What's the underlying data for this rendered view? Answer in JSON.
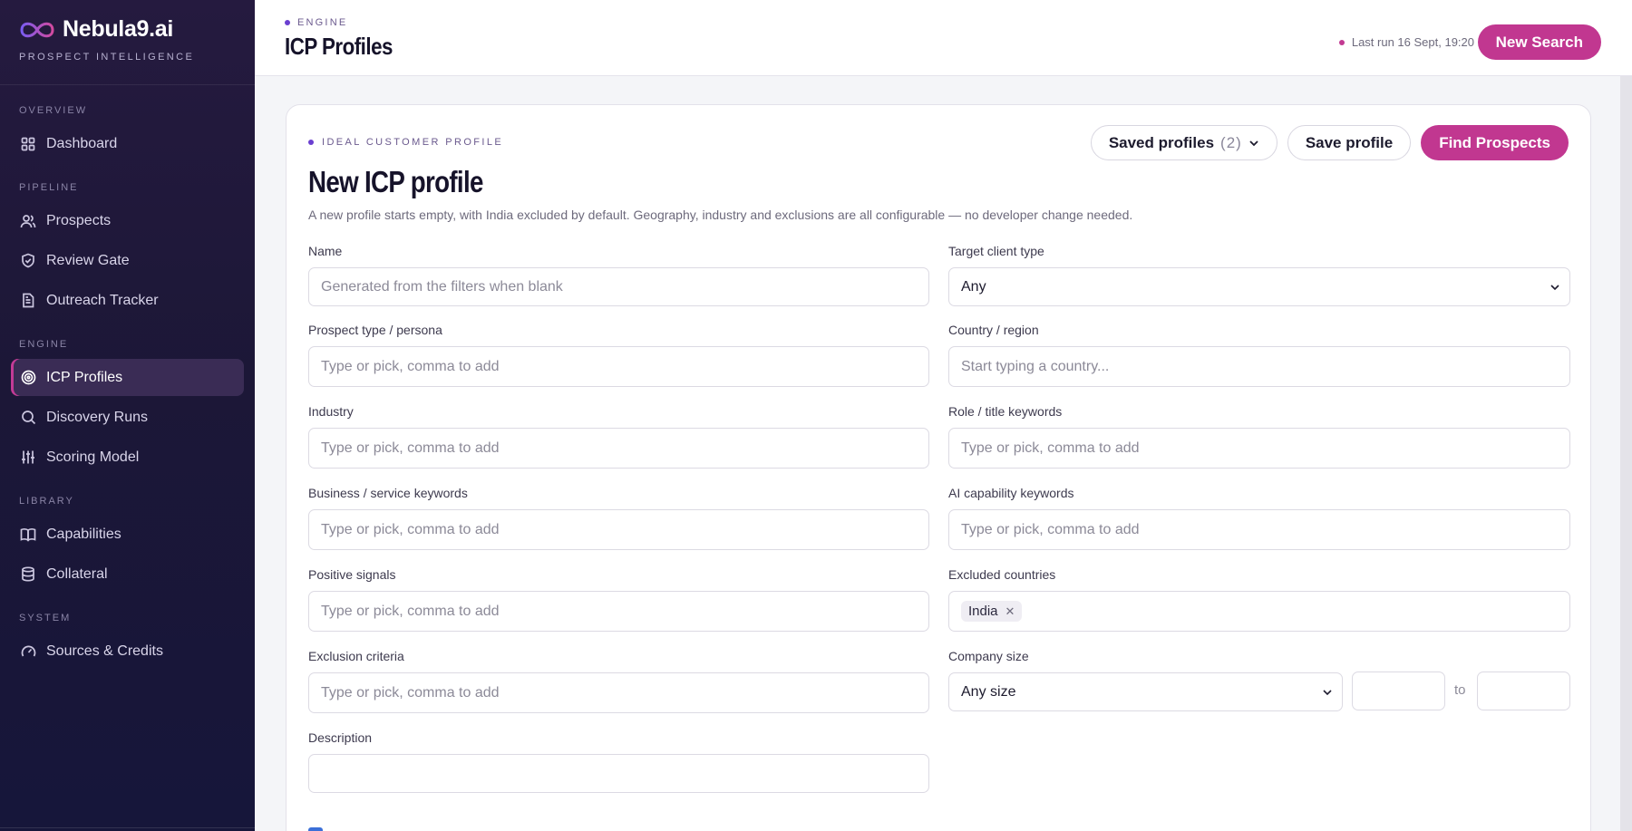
{
  "brand": {
    "name": "Nebula9.ai",
    "tagline": "PROSPECT INTELLIGENCE"
  },
  "sidebar": {
    "sections": [
      {
        "title": "OVERVIEW",
        "items": [
          {
            "label": "Dashboard",
            "icon": "grid-icon"
          }
        ]
      },
      {
        "title": "PIPELINE",
        "items": [
          {
            "label": "Prospects",
            "icon": "users-icon"
          },
          {
            "label": "Review Gate",
            "icon": "shield-check-icon"
          },
          {
            "label": "Outreach Tracker",
            "icon": "document-icon"
          }
        ]
      },
      {
        "title": "ENGINE",
        "items": [
          {
            "label": "ICP Profiles",
            "icon": "target-icon",
            "active": true
          },
          {
            "label": "Discovery Runs",
            "icon": "search-icon"
          },
          {
            "label": "Scoring Model",
            "icon": "sliders-icon"
          }
        ]
      },
      {
        "title": "LIBRARY",
        "items": [
          {
            "label": "Capabilities",
            "icon": "book-icon"
          },
          {
            "label": "Collateral",
            "icon": "database-icon"
          }
        ]
      },
      {
        "title": "SYSTEM",
        "items": [
          {
            "label": "Sources & Credits",
            "icon": "gauge-icon"
          }
        ]
      }
    ]
  },
  "topbar": {
    "breadcrumb": "ENGINE",
    "title": "ICP Profiles",
    "last_run": "Last run 16 Sept, 19:20",
    "new_search": "New Search"
  },
  "card": {
    "eyebrow": "IDEAL CUSTOMER PROFILE",
    "title": "New ICP profile",
    "subtitle": "A new profile starts empty, with India excluded by default. Geography, industry and exclusions are all configurable — no developer change needed.",
    "saved_profiles_label": "Saved profiles",
    "saved_profiles_count": "(2)",
    "save_profile": "Save profile",
    "find_prospects": "Find Prospects"
  },
  "form": {
    "name": {
      "label": "Name",
      "placeholder": "Generated from the filters when blank"
    },
    "target_client_type": {
      "label": "Target client type",
      "value": "Any"
    },
    "prospect_type": {
      "label": "Prospect type / persona",
      "placeholder": "Type or pick, comma to add"
    },
    "country": {
      "label": "Country / region",
      "placeholder": "Start typing a country..."
    },
    "industry": {
      "label": "Industry",
      "placeholder": "Type or pick, comma to add"
    },
    "role_keywords": {
      "label": "Role / title keywords",
      "placeholder": "Type or pick, comma to add"
    },
    "business_keywords": {
      "label": "Business / service keywords",
      "placeholder": "Type or pick, comma to add"
    },
    "ai_keywords": {
      "label": "AI capability keywords",
      "placeholder": "Type or pick, comma to add"
    },
    "positive_signals": {
      "label": "Positive signals",
      "placeholder": "Type or pick, comma to add"
    },
    "excluded_countries": {
      "label": "Excluded countries",
      "chips": [
        "India"
      ]
    },
    "exclusion_criteria": {
      "label": "Exclusion criteria",
      "placeholder": "Type or pick, comma to add"
    },
    "company_size": {
      "label": "Company size",
      "value": "Any size",
      "to": "to",
      "min": "",
      "max": ""
    },
    "description": {
      "label": "Description",
      "value": ""
    }
  }
}
